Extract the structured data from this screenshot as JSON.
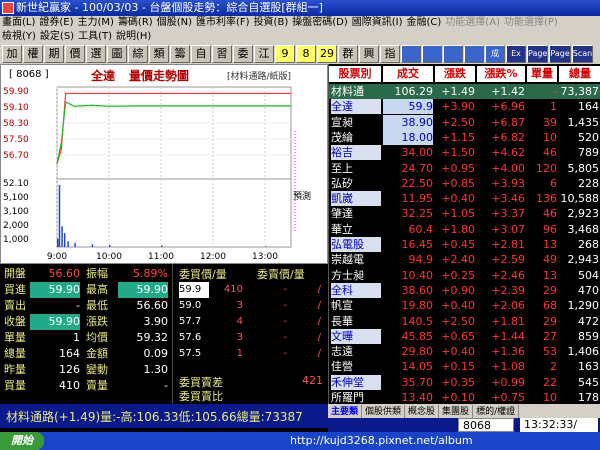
{
  "window": {
    "title": "新世紀贏家 - 100/03/03 - 台盤個股走勢：綜合自選股[群組一]"
  },
  "menu1": [
    "畫面(L)",
    "證券(E)",
    "主力(M)",
    "籌碼(R)",
    "個股(N)",
    "匯市利率(F)",
    "投資(B)",
    "操盤密碼(D)",
    "國際資訊(I)",
    "金融(C)",
    "功能選擇(A)",
    "功能選擇(P)"
  ],
  "menu2": [
    "檢視(Y)",
    "設定(S)",
    "工具(T)",
    "說明(H)"
  ],
  "toolbar": [
    "加",
    "權",
    "期",
    "價",
    "選",
    "圖",
    "綜",
    "類",
    "籌",
    "自",
    "習",
    "委",
    "江",
    "9",
    "8",
    "29",
    "群",
    "興",
    "指",
    "",
    "",
    "",
    "",
    "成",
    "Ex",
    "Page",
    "Page",
    "Scan"
  ],
  "chart": {
    "code": "[ 8068 ]",
    "name": "全達",
    "title": "量價走勢圖",
    "subtitle": "[材料通路/紙版]",
    "marker": "預測"
  },
  "chart_data": {
    "type": "line",
    "x_ticks": [
      "9:00",
      "10:00",
      "11:00",
      "12:00",
      "13:00"
    ],
    "price_ticks": [
      "59.90",
      "59.10",
      "58.30",
      "57.50",
      "56.70"
    ],
    "volume_ticks": [
      "52.10",
      "5,100",
      "3,100",
      "2,000",
      "1,000"
    ],
    "ylim_price": [
      56.0,
      60.2
    ],
    "series": [
      {
        "name": "",
        "color": "#ff3333",
        "x": [
          "9:00",
          "9:05",
          "9:10",
          "9:20",
          "9:40",
          "10:00",
          "10:30",
          "11:00",
          "11:30",
          "12:00",
          "12:30",
          "13:00",
          "13:30"
        ],
        "values": [
          56.6,
          57.3,
          59.9,
          59.9,
          59.9,
          59.9,
          59.9,
          59.9,
          59.9,
          59.9,
          59.9,
          59.9,
          59.9
        ]
      },
      {
        "name": "",
        "color": "#22bb22",
        "x": [
          "9:00",
          "9:05",
          "9:10",
          "9:20",
          "9:40",
          "10:00",
          "10:30",
          "11:00",
          "11:30",
          "12:00",
          "12:30",
          "13:00",
          "13:30"
        ],
        "values": [
          56.6,
          57.6,
          59.5,
          59.3,
          59.35,
          59.3,
          59.32,
          59.32,
          59.32,
          59.32,
          59.32,
          59.32,
          59.32
        ]
      }
    ],
    "volume": {
      "x": [
        "9:00",
        "9:02",
        "9:05",
        "9:08",
        "9:12",
        "9:20",
        "9:40",
        "10:00",
        "11:00",
        "13:00"
      ],
      "values": [
        120,
        900,
        300,
        200,
        80,
        60,
        40,
        30,
        20,
        10
      ]
    }
  },
  "quote": {
    "rows": [
      {
        "l1": "開盤",
        "v1": "56.60",
        "v1_color": "#ff4444",
        "l2": "振幅",
        "v2": "5.89%",
        "v2_color": "#ff4444"
      },
      {
        "l1": "買進",
        "v1": "59.90",
        "v1_color": "#ffffff",
        "l2": "最高",
        "v2": "59.90",
        "v2_color": "#ffffff"
      },
      {
        "l1": "賣出",
        "v1": "-",
        "v1_color": "#ffffff",
        "l2": "最低",
        "v2": "56.60",
        "v2_color": "#ffffff"
      },
      {
        "l1": "收盤",
        "v1": "59.90",
        "v1_color": "#ffffff",
        "l2": "漲跌",
        "v2": "3.90",
        "v2_color": "#ffffff"
      },
      {
        "l1": "單量",
        "v1": "1",
        "v1_color": "#ffffff",
        "l2": "均價",
        "v2": "59.32",
        "v2_color": "#ffffff"
      },
      {
        "l1": "總量",
        "v1": "164",
        "v1_color": "#ffffff",
        "l2": "金額",
        "v2": "0.09",
        "v2_color": "#ffffff"
      },
      {
        "l1": "昨量",
        "v1": "126",
        "v1_color": "#ffffff",
        "l2": "變動",
        "v2": "1.30",
        "v2_color": "#ffffff"
      },
      {
        "l1": "買量",
        "v1": "410",
        "v1_color": "#ffffff",
        "l2": "賣量",
        "v2": "-",
        "v2_color": "#ffffff"
      }
    ]
  },
  "book": {
    "bid_header": "委買價/量",
    "ask_header": "委賣價/量",
    "rows": [
      {
        "bp": "59.9",
        "bq": "410",
        "ap": "-",
        "aq": "/"
      },
      {
        "bp": "59.0",
        "bq": "3",
        "ap": "-",
        "aq": "/"
      },
      {
        "bp": "57.7",
        "bq": "4",
        "ap": "-",
        "aq": "/"
      },
      {
        "bp": "57.6",
        "bq": "3",
        "ap": "-",
        "aq": "/"
      },
      {
        "bp": "57.5",
        "bq": "1",
        "ap": "-",
        "aq": "/"
      }
    ],
    "diff_label": "委買賣差",
    "diff_value": "421",
    "ratio_label": "委買賣比"
  },
  "rank": {
    "headers": [
      "股票別",
      "成交",
      "漲跌",
      "漲跌%",
      "單量",
      "總量"
    ],
    "rows": [
      {
        "n": "材料通",
        "p": "106.29",
        "c": "+1.49",
        "pc": "+1.42",
        "v": "-",
        "tv": "73,387",
        "pcolor": "#ffffff",
        "hl": true
      },
      {
        "n": "全達",
        "p": "59.9",
        "c": "+3.90",
        "pc": "+6.96",
        "v": "1",
        "tv": "164",
        "pcolor": "#ff3333"
      },
      {
        "n": "宣昶",
        "p": "38.90",
        "c": "+2.50",
        "pc": "+6.87",
        "v": "39",
        "tv": "1,435",
        "pcolor": "#ff3333"
      },
      {
        "n": "茂綸",
        "p": "18.00",
        "c": "+1.15",
        "pc": "+6.82",
        "v": "10",
        "tv": "520",
        "pcolor": "#ff3333"
      },
      {
        "n": "裕吉",
        "p": "34.00",
        "c": "+1.50",
        "pc": "+4.62",
        "v": "46",
        "tv": "789",
        "pcolor": "#ff3333"
      },
      {
        "n": "至上",
        "p": "24.70",
        "c": "+0.95",
        "pc": "+4.00",
        "v": "120",
        "tv": "5,805",
        "pcolor": "#ff3333"
      },
      {
        "n": "弘矽",
        "p": "22.50",
        "c": "+0.85",
        "pc": "+3.93",
        "v": "6",
        "tv": "228",
        "pcolor": "#ff3333"
      },
      {
        "n": "凱崴",
        "p": "11.95",
        "c": "+0.40",
        "pc": "+3.46",
        "v": "136",
        "tv": "10,588",
        "pcolor": "#ff3333"
      },
      {
        "n": "肇達",
        "p": "32.25",
        "c": "+1.05",
        "pc": "+3.37",
        "v": "46",
        "tv": "2,923",
        "pcolor": "#ff3333"
      },
      {
        "n": "華立",
        "p": "60.4",
        "c": "+1.80",
        "pc": "+3.07",
        "v": "96",
        "tv": "3,468",
        "pcolor": "#ff3333"
      },
      {
        "n": "弘電股",
        "p": "16.45",
        "c": "+0.45",
        "pc": "+2.81",
        "v": "13",
        "tv": "268",
        "pcolor": "#ff3333"
      },
      {
        "n": "崇越電",
        "p": "94.9",
        "c": "+2.40",
        "pc": "+2.59",
        "v": "49",
        "tv": "2,943",
        "pcolor": "#ff3333"
      },
      {
        "n": "方士昶",
        "p": "10.40",
        "c": "+0.25",
        "pc": "+2.46",
        "v": "13",
        "tv": "504",
        "pcolor": "#ff3333"
      },
      {
        "n": "全科",
        "p": "38.60",
        "c": "+0.90",
        "pc": "+2.39",
        "v": "29",
        "tv": "470",
        "pcolor": "#ff3333"
      },
      {
        "n": "帆宣",
        "p": "19.80",
        "c": "+0.40",
        "pc": "+2.06",
        "v": "68",
        "tv": "1,290",
        "pcolor": "#ff3333"
      },
      {
        "n": "長華",
        "p": "140.5",
        "c": "+2.50",
        "pc": "+1.81",
        "v": "29",
        "tv": "472",
        "pcolor": "#ff3333"
      },
      {
        "n": "文曄",
        "p": "45.85",
        "c": "+0.65",
        "pc": "+1.44",
        "v": "27",
        "tv": "859",
        "pcolor": "#ff3333"
      },
      {
        "n": "志遠",
        "p": "29.80",
        "c": "+0.40",
        "pc": "+1.36",
        "v": "53",
        "tv": "1,406",
        "pcolor": "#ff3333"
      },
      {
        "n": "佳營",
        "p": "14.05",
        "c": "+0.15",
        "pc": "+1.08",
        "v": "2",
        "tv": "163",
        "pcolor": "#ff3333"
      },
      {
        "n": "禾伸堂",
        "p": "35.70",
        "c": "+0.35",
        "pc": "+0.99",
        "v": "22",
        "tv": "545",
        "pcolor": "#ff3333"
      },
      {
        "n": "所羅門",
        "p": "13.40",
        "c": "+0.10",
        "pc": "+0.75",
        "v": "10",
        "tv": "178",
        "pcolor": "#ff3333"
      }
    ],
    "tabs": [
      "主要類",
      "個股供類",
      "概念股",
      "集團股",
      "標的/權證"
    ]
  },
  "status": {
    "text": "材料通路(+1.49)量:-高:106.33低:105.66總量:73387",
    "code": "8068",
    "clock": "13:32:33/"
  },
  "taskbar": {
    "start": "開始",
    "watermark": "http://kujd3268.pixnet.net/album"
  }
}
